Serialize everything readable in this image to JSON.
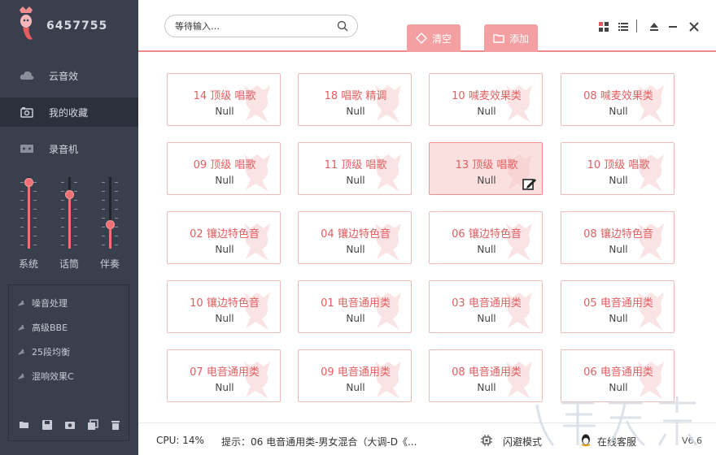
{
  "app": {
    "id": "6457755"
  },
  "sidebar": {
    "nav": [
      {
        "label": "云音效",
        "icon": "cloud-icon"
      },
      {
        "label": "我的收藏",
        "icon": "camera-icon"
      },
      {
        "label": "录音机",
        "icon": "recorder-icon"
      }
    ],
    "sliders": [
      {
        "label": "系统",
        "level": 0.93
      },
      {
        "label": "话筒",
        "level": 0.76
      },
      {
        "label": "伴奏",
        "level": 0.34
      }
    ],
    "effects": [
      "噪音处理",
      "高级BBE",
      "25段均衡",
      "混响效果C"
    ]
  },
  "header": {
    "search_placeholder": "等待输入…",
    "clear_label": "清空",
    "add_label": "添加"
  },
  "cards": [
    {
      "title": "14 顶级 唱歌",
      "sub": "Null"
    },
    {
      "title": "18 唱歌 精调",
      "sub": "Null"
    },
    {
      "title": "10 喊麦效果类",
      "sub": "Null"
    },
    {
      "title": "08 喊麦效果类",
      "sub": "Null"
    },
    {
      "title": "09 顶级 唱歌",
      "sub": "Null"
    },
    {
      "title": "11 顶级 唱歌",
      "sub": "Null"
    },
    {
      "title": "13 顶级 唱歌",
      "sub": "Null",
      "selected": true
    },
    {
      "title": "10 顶级 唱歌",
      "sub": "Null"
    },
    {
      "title": "02 镶边特色音",
      "sub": "Null"
    },
    {
      "title": "04 镶边特色音",
      "sub": "Null"
    },
    {
      "title": "06 镶边特色音",
      "sub": "Null"
    },
    {
      "title": "08 镶边特色音",
      "sub": "Null"
    },
    {
      "title": "10 镶边特色音",
      "sub": "Null"
    },
    {
      "title": "01 电音通用类",
      "sub": "Null"
    },
    {
      "title": "03 电音通用类",
      "sub": "Null"
    },
    {
      "title": "05 电音通用类",
      "sub": "Null"
    },
    {
      "title": "07 电音通用类",
      "sub": "Null"
    },
    {
      "title": "09 电音通用类",
      "sub": "Null"
    },
    {
      "title": "08 电音通用类",
      "sub": "Null"
    },
    {
      "title": "06 电音通用类",
      "sub": "Null"
    }
  ],
  "status": {
    "cpu": "CPU: 14%",
    "tip": "提示：06  电音通用类-男女混合（大调-D《...",
    "mode": "闪避模式",
    "online": "在线客服",
    "version": "V6.6"
  },
  "colors": {
    "accent": "#ef6f72",
    "sidebar_bg": "#3a3f4e",
    "tab_bg": "#f4a0a2"
  }
}
